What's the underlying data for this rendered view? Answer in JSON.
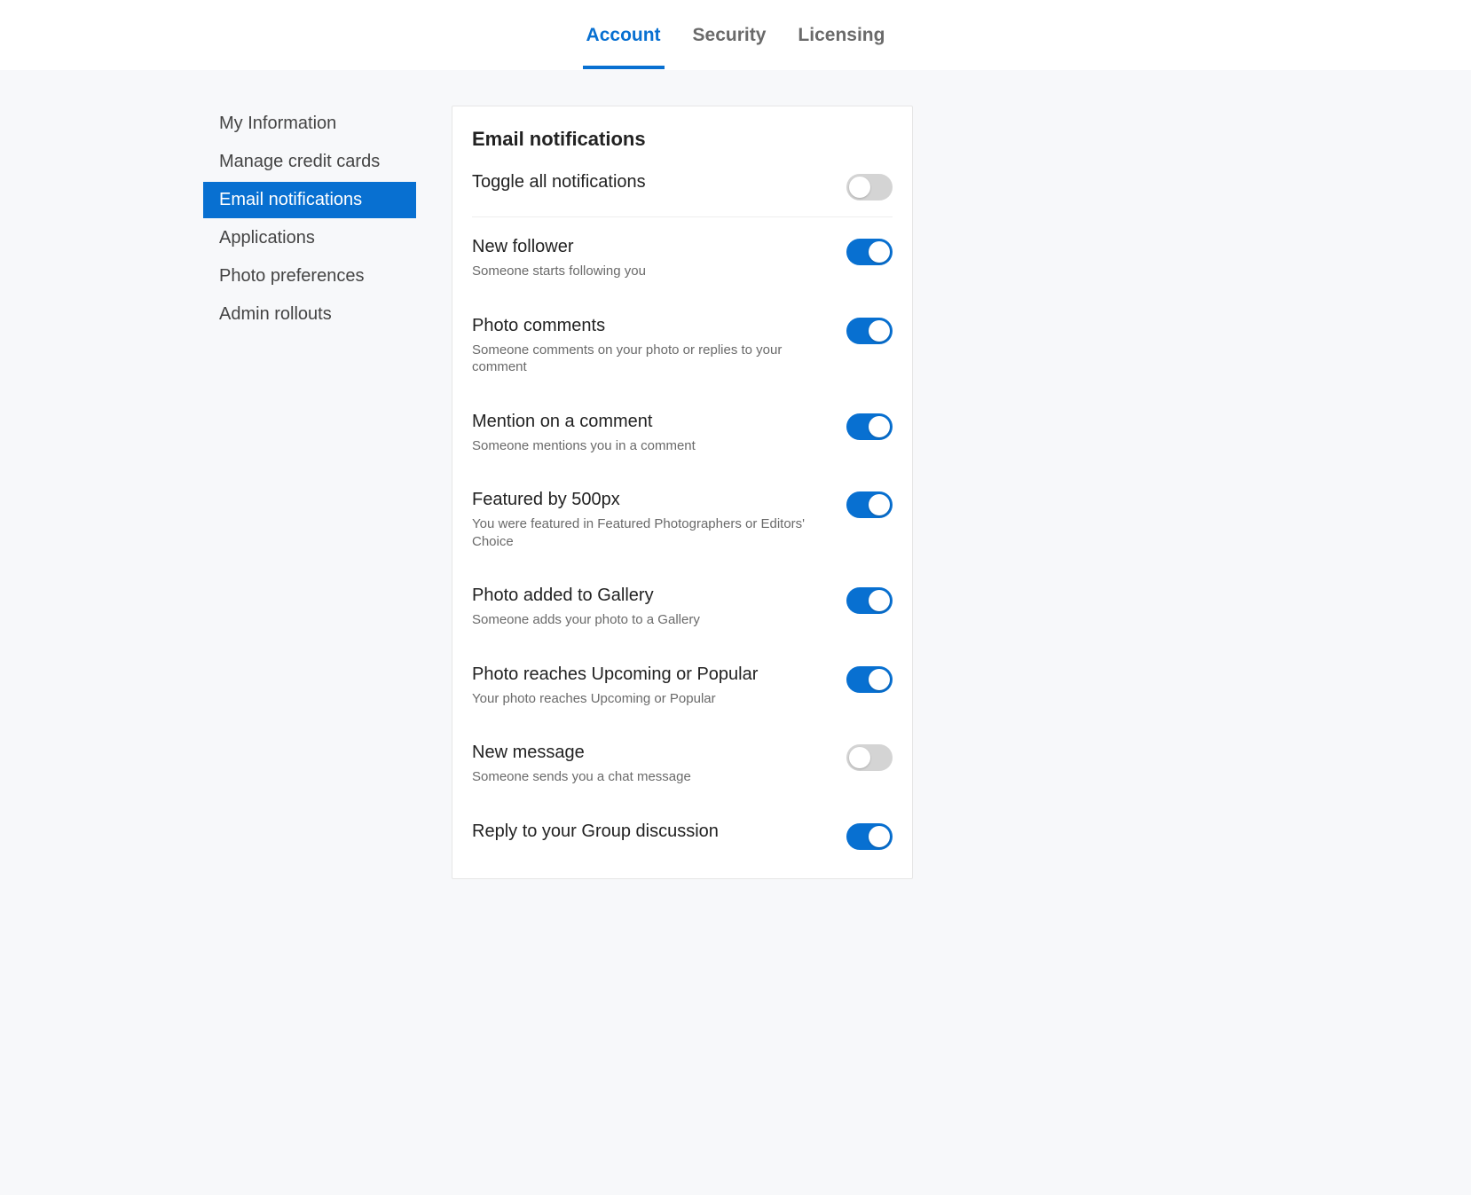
{
  "tabs": {
    "account": "Account",
    "security": "Security",
    "licensing": "Licensing",
    "active": "account"
  },
  "sidebar": {
    "items": [
      {
        "id": "my-info",
        "label": "My Information"
      },
      {
        "id": "manage-cc",
        "label": "Manage credit cards"
      },
      {
        "id": "email-notifications",
        "label": "Email notifications"
      },
      {
        "id": "applications",
        "label": "Applications"
      },
      {
        "id": "photo-preferences",
        "label": "Photo preferences"
      },
      {
        "id": "admin-rollouts",
        "label": "Admin rollouts"
      }
    ],
    "active": "email-notifications"
  },
  "content": {
    "heading": "Email notifications",
    "toggle_all": {
      "label": "Toggle all notifications",
      "on": false
    },
    "notifications": [
      {
        "id": "new-follower",
        "title": "New follower",
        "desc": "Someone starts following you",
        "on": true
      },
      {
        "id": "photo-comments",
        "title": "Photo comments",
        "desc": "Someone comments on your photo or replies to your comment",
        "on": true
      },
      {
        "id": "mention-comment",
        "title": "Mention on a comment",
        "desc": "Someone mentions you in a comment",
        "on": true
      },
      {
        "id": "featured-500px",
        "title": "Featured by 500px",
        "desc": "You were featured in Featured Photographers or Editors' Choice",
        "on": true
      },
      {
        "id": "photo-gallery",
        "title": "Photo added to Gallery",
        "desc": "Someone adds your photo to a Gallery",
        "on": true
      },
      {
        "id": "photo-upcoming-popular",
        "title": "Photo reaches Upcoming or Popular",
        "desc": "Your photo reaches Upcoming or Popular",
        "on": true
      },
      {
        "id": "new-message",
        "title": "New message",
        "desc": "Someone sends you a chat message",
        "on": false
      },
      {
        "id": "reply-group",
        "title": "Reply to your Group discussion",
        "desc": "",
        "on": true
      }
    ]
  }
}
